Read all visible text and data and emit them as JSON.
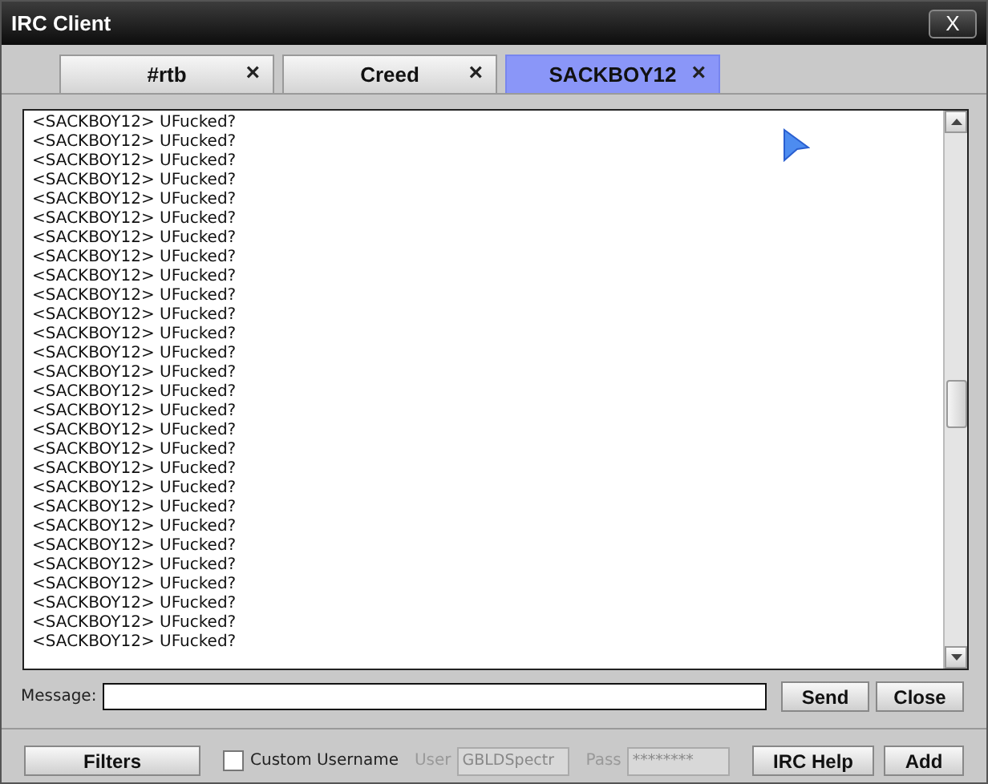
{
  "window": {
    "title": "IRC Client",
    "close": "X"
  },
  "tabs": [
    {
      "label": "#rtb",
      "close": "×",
      "selected": false
    },
    {
      "label": "Creed",
      "close": "×",
      "selected": false
    },
    {
      "label": "SACKBOY12",
      "close": "×",
      "selected": true
    }
  ],
  "chat": {
    "lines": [
      "<SACKBOY12> UFucked?",
      "<SACKBOY12> UFucked?",
      "<SACKBOY12> UFucked?",
      "<SACKBOY12> UFucked?",
      "<SACKBOY12> UFucked?",
      "<SACKBOY12> UFucked?",
      "<SACKBOY12> UFucked?",
      "<SACKBOY12> UFucked?",
      "<SACKBOY12> UFucked?",
      "<SACKBOY12> UFucked?",
      "<SACKBOY12> UFucked?",
      "<SACKBOY12> UFucked?",
      "<SACKBOY12> UFucked?",
      "<SACKBOY12> UFucked?",
      "<SACKBOY12> UFucked?",
      "<SACKBOY12> UFucked?",
      "<SACKBOY12> UFucked?",
      "<SACKBOY12> UFucked?",
      "<SACKBOY12> UFucked?",
      "<SACKBOY12> UFucked?",
      "<SACKBOY12> UFucked?",
      "<SACKBOY12> UFucked?",
      "<SACKBOY12> UFucked?",
      "<SACKBOY12> UFucked?",
      "<SACKBOY12> UFucked?",
      "<SACKBOY12> UFucked?",
      "<SACKBOY12> UFucked?",
      "<SACKBOY12> UFucked?"
    ]
  },
  "message": {
    "label": "Message:",
    "buttons": [
      "Send",
      "Close"
    ]
  },
  "footer": {
    "filters": "Filters",
    "custom_username": {
      "label": "Custom Username",
      "checked": false
    },
    "user": {
      "label": "User",
      "value": "GBLDSpectr",
      "disabled": true
    },
    "pass": {
      "label": "Pass",
      "value": "********",
      "disabled": true
    },
    "buttons": [
      "IRC Help",
      "Add"
    ]
  }
}
